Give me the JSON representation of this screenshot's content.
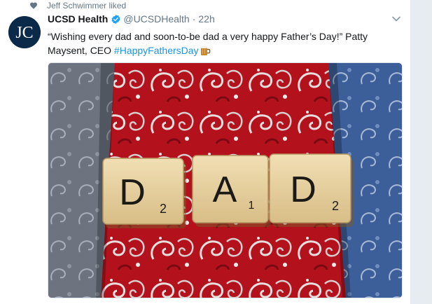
{
  "context": {
    "icon": "heart-icon",
    "text": "Jeff Schwimmer liked"
  },
  "tweet": {
    "avatar_text": "JC",
    "author_name": "UCSD Health",
    "handle": "@UCSDHealth",
    "separator": "·",
    "time": "22h",
    "text_main": "“Wishing every dad and soon-to-be dad a very happy Father’s Day!” Patty Maysent, CEO ",
    "hashtag": "#HappyFathersDay",
    "emoji": "beer-mug-emoji"
  },
  "media": {
    "tiles": [
      {
        "letter": "D",
        "value": "2"
      },
      {
        "letter": "A",
        "value": "1"
      },
      {
        "letter": "D",
        "value": "2"
      }
    ]
  },
  "colors": {
    "link": "#1b95e0",
    "muted": "#657786",
    "verified": "#1da1f2",
    "tie_red": "#b5121b",
    "tile": "#e6cf9f"
  }
}
